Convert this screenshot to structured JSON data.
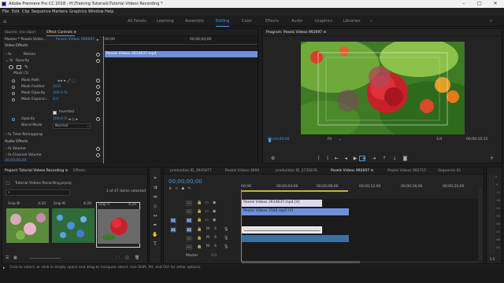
{
  "titlebar": {
    "title": "Adobe Premiere Pro CC 2018 - H:\\Training Tutorials\\Tutorial Videos Recording *",
    "minimize": "–",
    "maximize": "□",
    "close": "✕"
  },
  "menu": [
    "File",
    "Edit",
    "Clip",
    "Sequence",
    "Markers",
    "Graphics",
    "Window",
    "Help"
  ],
  "workspaces": {
    "items": [
      "All Panels",
      "Learning",
      "Assembly",
      "Editing",
      "Color",
      "Effects",
      "Audio",
      "Graphics",
      "Libraries"
    ],
    "active": "Editing",
    "more": "»"
  },
  "effect_controls": {
    "tabs": [
      "Source: (no clips)",
      "Effect Controls ≡"
    ],
    "master": "Master * Pexels Video...",
    "master_clip": "Pexels Videos 992697...",
    "ruler_start": "00;00",
    "ruler_mid": "00;00;04;00",
    "clip_bar": "Pexels Videos 2614637.mp4",
    "video_effects": "Video Effects",
    "motion": "Motion",
    "opacity": "Opacity",
    "mask": "Mask (1)",
    "mask_path": "Mask Path",
    "mask_feather": "Mask Feather",
    "mask_feather_val": "10.0",
    "mask_opacity": "Mask Opacity",
    "mask_opacity_val": "100.0 %",
    "mask_expansion": "Mask Expansi...",
    "mask_expansion_val": "0.0",
    "inverted": "Inverted",
    "opacity_prop": "Opacity",
    "opacity_val": "100.0 %",
    "blend_mode": "Blend Mode",
    "blend_val": "Normal",
    "time_remap": "Time Remapping",
    "audio_effects": "Audio Effects",
    "volume": "Volume",
    "channel_volume": "Channel Volume",
    "timecode": "00;00;00;00"
  },
  "program": {
    "title": "Program: Pexels Videos 992697 ≡",
    "timecode": "00;00;00;00",
    "fit": "Fit",
    "fraction": "1/4",
    "duration": "00;00;10;15"
  },
  "project": {
    "tabs": [
      "Project: Tutorial Videos Recording ≡",
      "Effects"
    ],
    "file": "Tutorial Videos Recording.prproj",
    "selection": "1 of 47 items selected",
    "items": [
      {
        "label": "Snip Bi",
        "dur": "4;20"
      },
      {
        "label": "Snip Ki",
        "dur": "4;20"
      },
      {
        "label": "Snip II",
        "dur": "4;20"
      }
    ]
  },
  "timeline": {
    "tabs": [
      "production ID_3945877",
      "Pexels Videos 4690",
      "production ID_3735676",
      "Pexels Videos 992697 ≡",
      "Pexels Videos 992715",
      "Sequence 01"
    ],
    "active_tab": 3,
    "timecode": "00;00;00;00",
    "ruler": [
      "00;00",
      "00;00;04;00",
      "00;00;08;00",
      "00;00;12;00",
      "00;00;16;00",
      "00;00;20;00"
    ],
    "video_tracks": [
      "V3",
      "V2",
      "V1"
    ],
    "audio_tracks": [
      "A1",
      "A2",
      "A3"
    ],
    "master": "Master",
    "master_val": "0.0",
    "clip_v3": "Pexels Videos 2614637.mp4 [V]",
    "clip_v2": "Pexels Videos 3144.mp4 [V]",
    "v1_label": "V1",
    "a1_label": "A1"
  },
  "meter_scale": [
    "0",
    "-6",
    "-12",
    "-18",
    "-24",
    "-30",
    "-36",
    "-42",
    "-48",
    "-54"
  ],
  "status": "Click to select, or click in empty space and drag to marquee select. Use Shift, Alt, and Ctrl for other options.",
  "colors": {
    "accent": "#3d9be9",
    "clip_blue": "#6f8fd8",
    "clip_light": "#dcdcf0",
    "audio_clip": "#3f6f9e"
  }
}
